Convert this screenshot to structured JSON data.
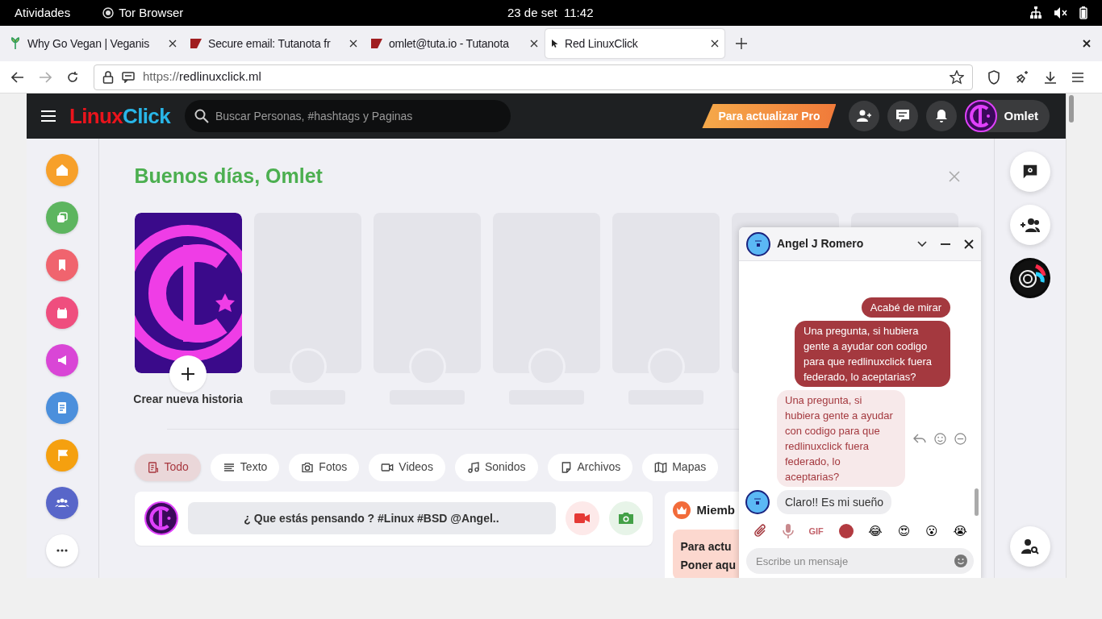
{
  "system_bar": {
    "activities": "Atividades",
    "app": "Tor Browser",
    "clock": "23 de set  11:42"
  },
  "tabs": [
    {
      "title": "Why Go Vegan | Veganis",
      "selected": false
    },
    {
      "title": "Secure email: Tutanota fr",
      "selected": false
    },
    {
      "title": "omlet@tuta.io - Tutanota",
      "selected": false
    },
    {
      "title": "Red LinuxClick",
      "selected": true
    }
  ],
  "address_bar": {
    "scheme": "https://",
    "host": "redlinuxclick.ml"
  },
  "header": {
    "logo_part_1": "Linux",
    "logo_part_2": "Click",
    "search_placeholder": "Buscar Personas, #hashtags y Paginas",
    "pro_button": "Para actualizar Pro",
    "user_name": "Omlet"
  },
  "sidebar": {
    "items": [
      {
        "kind": "home",
        "color": "#f7a02a"
      },
      {
        "kind": "pages",
        "color": "#5db55f"
      },
      {
        "kind": "bookmark",
        "color": "#f0646e"
      },
      {
        "kind": "calendar",
        "color": "#ef4e7e"
      },
      {
        "kind": "megaphone",
        "color": "#d946d6"
      },
      {
        "kind": "article",
        "color": "#4b8fdc"
      },
      {
        "kind": "flag",
        "color": "#f5a00f"
      },
      {
        "kind": "group",
        "color": "#5866c9"
      },
      {
        "kind": "more",
        "color": "#ffffff"
      }
    ]
  },
  "greeting": "Buenos días, Omlet",
  "stories": {
    "create_label": "Crear nueva historia"
  },
  "filters": [
    {
      "label": "Todo",
      "selected": true
    },
    {
      "label": "Texto",
      "selected": false
    },
    {
      "label": "Fotos",
      "selected": false
    },
    {
      "label": "Videos",
      "selected": false
    },
    {
      "label": "Sonidos",
      "selected": false
    },
    {
      "label": "Archivos",
      "selected": false
    },
    {
      "label": "Mapas",
      "selected": false
    }
  ],
  "composer": {
    "placeholder": "¿ Que estás pensando ? #Linux #BSD @Angel.."
  },
  "members_card": {
    "title": "Miemb",
    "lines": [
      "Para actu",
      "Poner aqu"
    ]
  },
  "right_rail": [
    {
      "kind": "chat-settings"
    },
    {
      "kind": "add-group"
    },
    {
      "kind": "avatar"
    },
    {
      "kind": "find-person"
    }
  ],
  "chat": {
    "name": "Angel J Romero",
    "messages": [
      {
        "kind": "sent",
        "text": "Acabé de mirar"
      },
      {
        "kind": "sent",
        "text": "Una pregunta, si hubiera gente a ayudar con codigo para que redlinuxclick fuera federado, lo aceptarias?"
      },
      {
        "kind": "quoted",
        "text": "Una pregunta, si hubiera gente a ayudar con codigo para que redlinuxclick fuera federado, lo aceptarias?"
      },
      {
        "kind": "received",
        "text": "Claro!! Es mi sueño"
      }
    ],
    "gif": "GIF",
    "reactions": [
      "😂",
      "😍",
      "😮",
      "😭"
    ],
    "input_placeholder": "Escribe un mensaje"
  }
}
